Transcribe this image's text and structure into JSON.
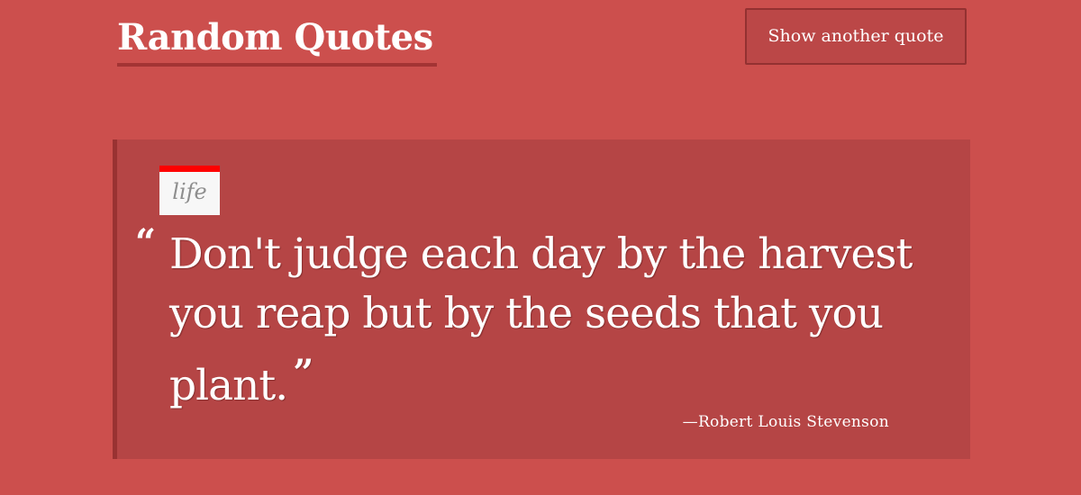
{
  "header": {
    "title": "Random Quotes",
    "button_label": "Show another quote"
  },
  "quote": {
    "tag": "life",
    "open_mark": "“",
    "text": "Don't judge each day by the harvest you reap but by the seeds that you plant.",
    "close_mark": "”",
    "author": "—Robert Louis Stevenson"
  },
  "colors": {
    "page_background": "#cc4f4d",
    "card_background": "#b54545",
    "card_border": "#993232",
    "tag_accent": "#ff0000",
    "title_underline": "#a33434",
    "button_background": "#bb4747"
  }
}
